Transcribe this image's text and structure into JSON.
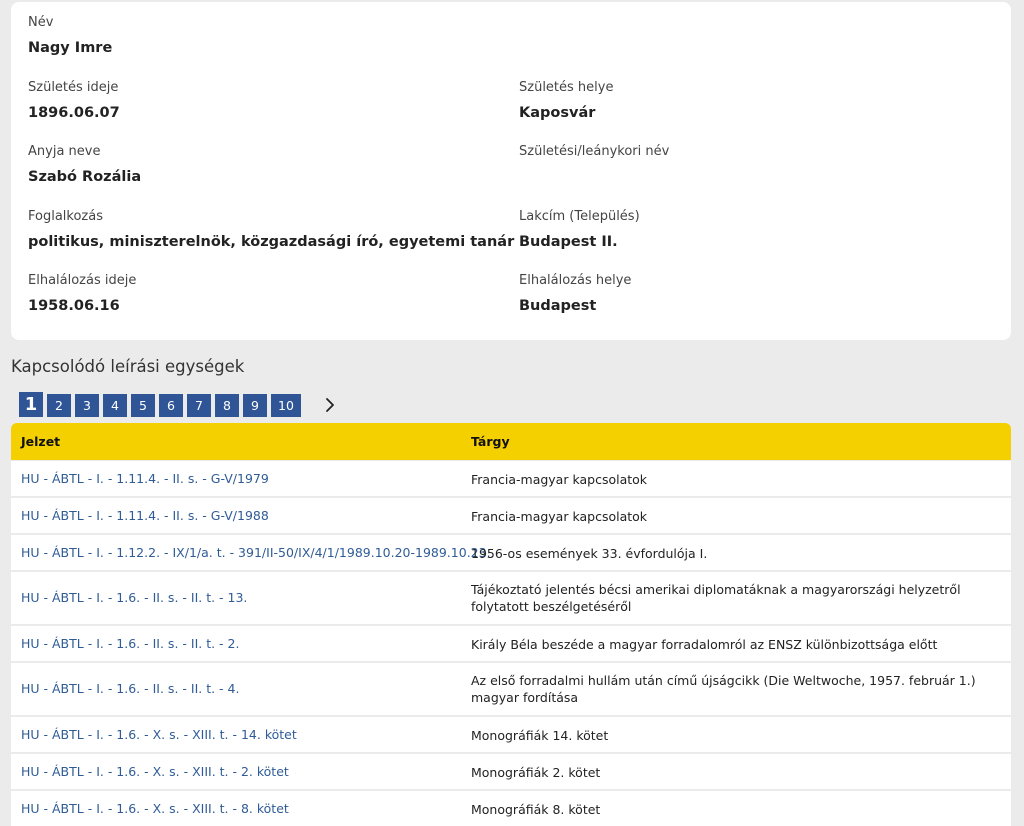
{
  "person": {
    "name_label": "Név",
    "name_value": "Nagy Imre",
    "birth_date_label": "Születés ideje",
    "birth_date_value": "1896.06.07",
    "birth_place_label": "Születés helye",
    "birth_place_value": "Kaposvár",
    "mother_label": "Anyja neve",
    "mother_value": "Szabó Rozália",
    "maiden_label": "Születési/leánykori név",
    "maiden_value": "",
    "occupation_label": "Foglalkozás",
    "occupation_value": "politikus, miniszterelnök, közgazdasági író, egyetemi tanár",
    "residence_label": "Lakcím (Település)",
    "residence_value": "Budapest II.",
    "death_date_label": "Elhalálozás ideje",
    "death_date_value": "1958.06.16",
    "death_place_label": "Elhalálozás helye",
    "death_place_value": "Budapest"
  },
  "related": {
    "title": "Kapcsolódó leírási egységek",
    "pagination": {
      "pages": [
        "1",
        "2",
        "3",
        "4",
        "5",
        "6",
        "7",
        "8",
        "9",
        "10"
      ],
      "current": "1",
      "next_icon": "chevron-right-icon"
    },
    "columns": {
      "code": "Jelzet",
      "subject": "Tárgy"
    },
    "rows": [
      {
        "code": "HU - ÁBTL - I. - 1.11.4. - II. s. - G-V/1979",
        "subject": "Francia-magyar kapcsolatok"
      },
      {
        "code": "HU - ÁBTL - I. - 1.11.4. - II. s. - G-V/1988",
        "subject": "Francia-magyar kapcsolatok"
      },
      {
        "code": "HU - ÁBTL - I. - 1.12.2. - IX/1/a. t. - 391/II-50/IX/4/1/1989.10.20-1989.10.23.",
        "subject": "1956-os események 33. évfordulója I."
      },
      {
        "code": "HU - ÁBTL - I. - 1.6. - II. s. - II. t. - 13.",
        "subject": "Tájékoztató jelentés bécsi amerikai diplomatáknak a magyarországi helyzetről folytatott beszélgetéséről"
      },
      {
        "code": "HU - ÁBTL - I. - 1.6. - II. s. - II. t. - 2.",
        "subject": "Király Béla beszéde a magyar forradalomról az ENSZ különbizottsága előtt"
      },
      {
        "code": "HU - ÁBTL - I. - 1.6. - II. s. - II. t. - 4.",
        "subject": "Az első forradalmi hullám után című újságcikk (Die Weltwoche, 1957. február 1.) magyar fordítása"
      },
      {
        "code": "HU - ÁBTL - I. - 1.6. - X. s. - XIII. t. - 14. kötet",
        "subject": "Monográfiák 14. kötet"
      },
      {
        "code": "HU - ÁBTL - I. - 1.6. - X. s. - XIII. t. - 2. kötet",
        "subject": "Monográfiák 2. kötet"
      },
      {
        "code": "HU - ÁBTL - I. - 1.6. - X. s. - XIII. t. - 8. kötet",
        "subject": "Monográfiák 8. kötet"
      }
    ]
  },
  "colors": {
    "header_bg": "#f5d000",
    "link": "#2f5c97",
    "pager_bg": "#2f5597",
    "page_bg": "#ebebeb"
  }
}
